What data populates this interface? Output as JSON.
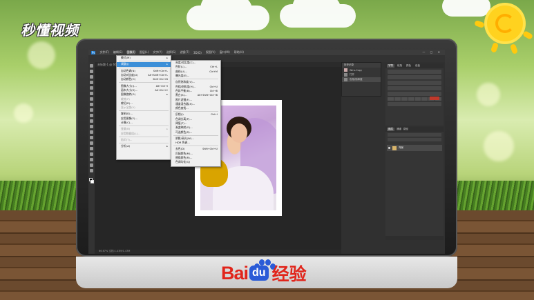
{
  "brand": {
    "logo_text": "秒懂视频",
    "footer_bai": "Bai",
    "footer_du": "du",
    "footer_cn": "经验"
  },
  "photoshop": {
    "menubar": [
      "文件(F)",
      "编辑(E)",
      "图像(I)",
      "图层(L)",
      "文字(Y)",
      "选择(S)",
      "滤镜(T)",
      "3D(D)",
      "视图(V)",
      "窗口(W)",
      "帮助(H)"
    ],
    "active_menu_index": 2,
    "tab_label": "未标题-1 @ 66.7% (RGB/8)",
    "image_menu": [
      {
        "label": "模式(M)",
        "shortcut": "",
        "arrow": true
      },
      {
        "sep": true
      },
      {
        "label": "调整(J)",
        "shortcut": "",
        "arrow": true,
        "highlight": true
      },
      {
        "sep": true
      },
      {
        "label": "自动色调(N)",
        "shortcut": "Shift+Ctrl+L"
      },
      {
        "label": "自动对比度(U)",
        "shortcut": "Alt+Shift+Ctrl+L"
      },
      {
        "label": "自动颜色(O)",
        "shortcut": "Shift+Ctrl+B"
      },
      {
        "sep": true
      },
      {
        "label": "图像大小(I)...",
        "shortcut": "Alt+Ctrl+I"
      },
      {
        "label": "画布大小(S)...",
        "shortcut": "Alt+Ctrl+C"
      },
      {
        "label": "图像旋转(G)",
        "shortcut": "",
        "arrow": true
      },
      {
        "label": "裁剪(P)",
        "shortcut": "",
        "disabled": true
      },
      {
        "label": "裁切(R)...",
        "shortcut": ""
      },
      {
        "label": "显示全部(V)",
        "shortcut": "",
        "disabled": true
      },
      {
        "sep": true
      },
      {
        "label": "复制(D)...",
        "shortcut": ""
      },
      {
        "label": "应用图像(Y)...",
        "shortcut": ""
      },
      {
        "label": "计算(C)...",
        "shortcut": ""
      },
      {
        "sep": true
      },
      {
        "label": "变量(B)",
        "shortcut": "",
        "arrow": true,
        "disabled": true
      },
      {
        "label": "应用数据组(L)...",
        "shortcut": "",
        "disabled": true
      },
      {
        "sep": true
      },
      {
        "label": "陷印(T)...",
        "shortcut": "",
        "disabled": true
      },
      {
        "sep": true
      },
      {
        "label": "分析(A)",
        "shortcut": "",
        "arrow": true
      }
    ],
    "adjust_menu": [
      {
        "label": "亮度/对比度(C)...",
        "shortcut": ""
      },
      {
        "label": "色阶(L)...",
        "shortcut": "Ctrl+L"
      },
      {
        "label": "曲线(U)...",
        "shortcut": "Ctrl+M"
      },
      {
        "label": "曝光度(E)...",
        "shortcut": ""
      },
      {
        "sep": true
      },
      {
        "label": "自然饱和度(V)...",
        "shortcut": ""
      },
      {
        "label": "色相/饱和度(H)...",
        "shortcut": "Ctrl+U"
      },
      {
        "label": "色彩平衡(B)...",
        "shortcut": "Ctrl+B"
      },
      {
        "label": "黑白(K)...",
        "shortcut": "Alt+Shift+Ctrl+B"
      },
      {
        "label": "照片滤镜(F)...",
        "shortcut": ""
      },
      {
        "label": "通道混合器(X)...",
        "shortcut": ""
      },
      {
        "label": "颜色查找...",
        "shortcut": ""
      },
      {
        "sep": true
      },
      {
        "label": "反相(I)",
        "shortcut": "Ctrl+I"
      },
      {
        "label": "色调分离(P)...",
        "shortcut": ""
      },
      {
        "label": "阈值(T)...",
        "shortcut": ""
      },
      {
        "label": "渐变映射(G)...",
        "shortcut": ""
      },
      {
        "label": "可选颜色(S)...",
        "shortcut": ""
      },
      {
        "sep": true
      },
      {
        "label": "阴影/高光(W)...",
        "shortcut": ""
      },
      {
        "label": "HDR 色调...",
        "shortcut": ""
      },
      {
        "sep": true
      },
      {
        "label": "去色(D)",
        "shortcut": "Shift+Ctrl+U"
      },
      {
        "label": "匹配颜色(M)...",
        "shortcut": ""
      },
      {
        "label": "替换颜色(R)...",
        "shortcut": ""
      },
      {
        "label": "色调均化(Q)",
        "shortcut": ""
      }
    ],
    "history_panel": {
      "tab": "历史记录",
      "rows": [
        "Wira-Copy",
        "打开",
        "色相/饱和度"
      ]
    },
    "char_panel": {
      "tabs": [
        "字符",
        "段落",
        "颜色",
        "色板"
      ]
    },
    "layers_panel": {
      "tabs": [
        "图层",
        "通道",
        "路径"
      ],
      "layer_name": "背景"
    },
    "status_text": "66.67%   文档:1.43M/1.43M"
  }
}
